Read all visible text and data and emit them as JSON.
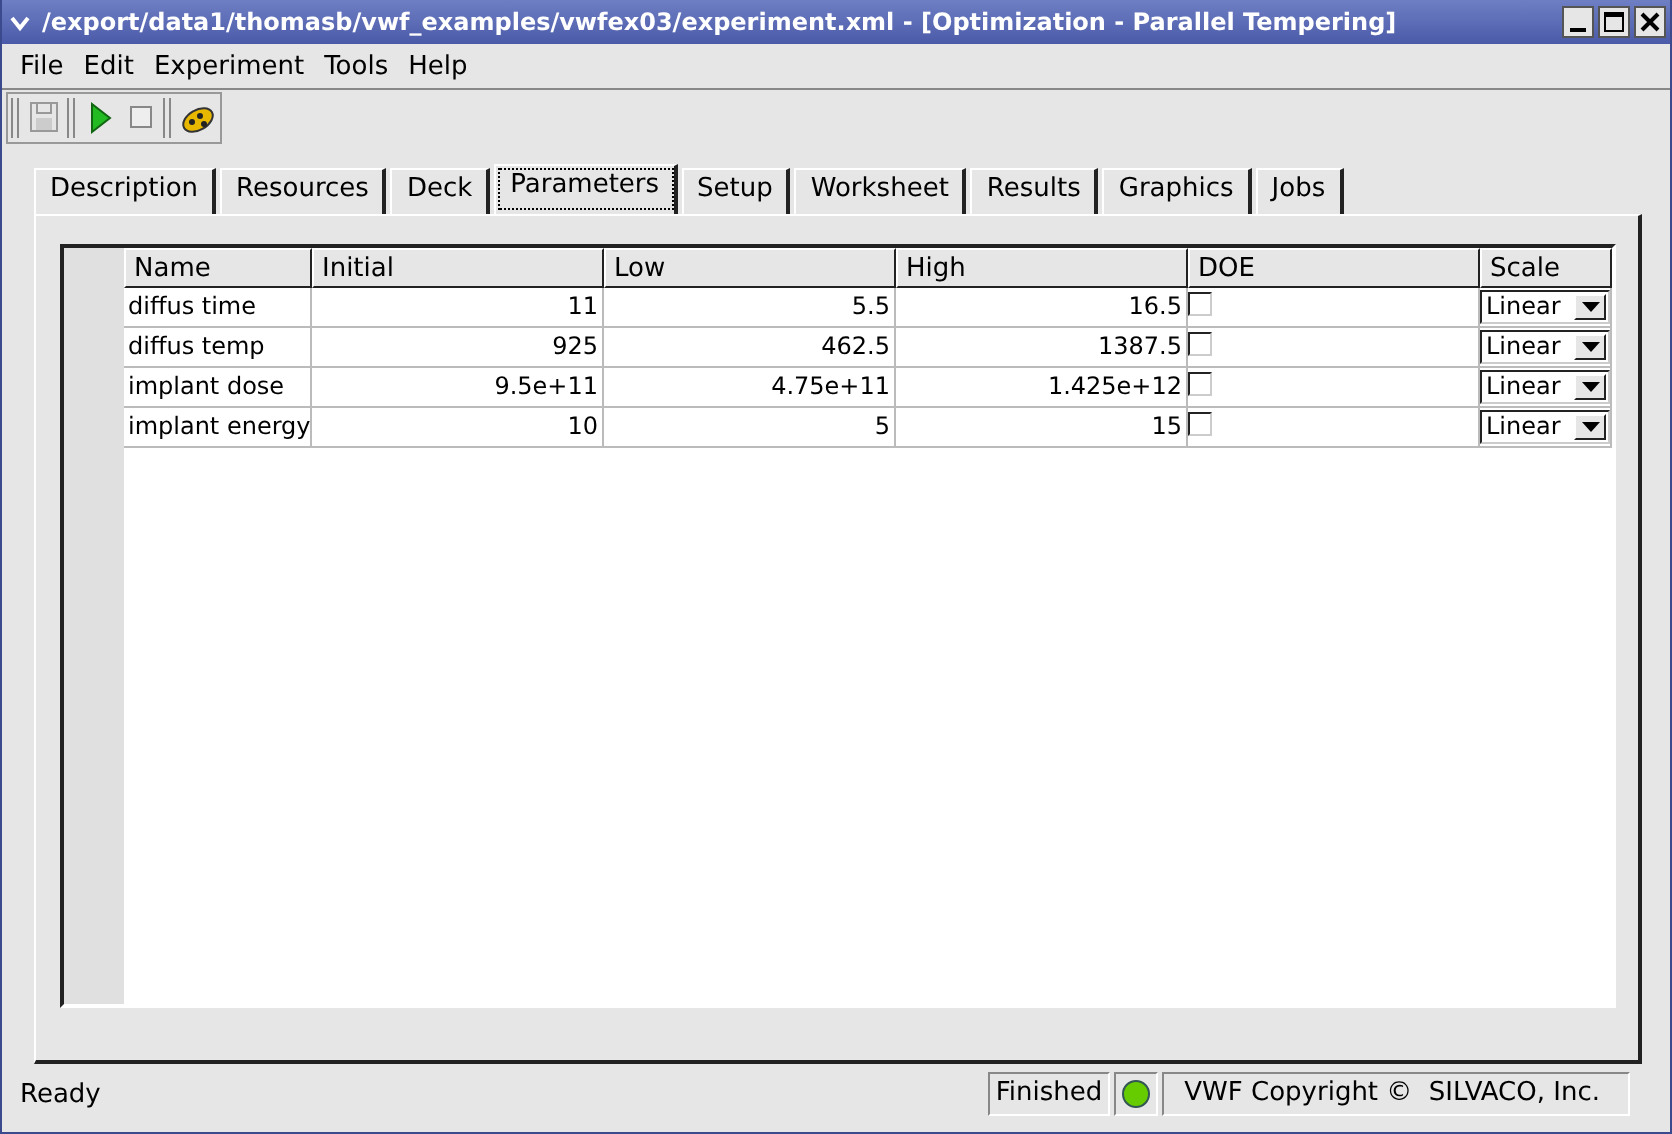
{
  "window": {
    "title": "/export/data1/thomasb/vwf_examples/vwfex03/experiment.xml - [Optimization - Parallel Tempering]"
  },
  "menu": [
    "File",
    "Edit",
    "Experiment",
    "Tools",
    "Help"
  ],
  "tabs": [
    {
      "label": "Description",
      "selected": false
    },
    {
      "label": "Resources",
      "selected": false
    },
    {
      "label": "Deck",
      "selected": false
    },
    {
      "label": "Parameters",
      "selected": true
    },
    {
      "label": "Setup",
      "selected": false
    },
    {
      "label": "Worksheet",
      "selected": false
    },
    {
      "label": "Results",
      "selected": false
    },
    {
      "label": "Graphics",
      "selected": false
    },
    {
      "label": "Jobs",
      "selected": false
    }
  ],
  "table": {
    "columns": [
      "Name",
      "Initial",
      "Low",
      "High",
      "DOE",
      "Scale"
    ],
    "rows": [
      {
        "name": "diffus time",
        "initial": "11",
        "low": "5.5",
        "high": "16.5",
        "doe": false,
        "scale": "Linear"
      },
      {
        "name": "diffus temp",
        "initial": "925",
        "low": "462.5",
        "high": "1387.5",
        "doe": false,
        "scale": "Linear"
      },
      {
        "name": "implant dose",
        "initial": "9.5e+11",
        "low": "4.75e+11",
        "high": "1.425e+12",
        "doe": false,
        "scale": "Linear"
      },
      {
        "name": "implant energy",
        "initial": "10",
        "low": "5",
        "high": "15",
        "doe": false,
        "scale": "Linear"
      }
    ]
  },
  "status_bar": {
    "message": "Ready",
    "state": "Finished",
    "copyright": "VWF Copyright ©  SILVACO, Inc."
  }
}
